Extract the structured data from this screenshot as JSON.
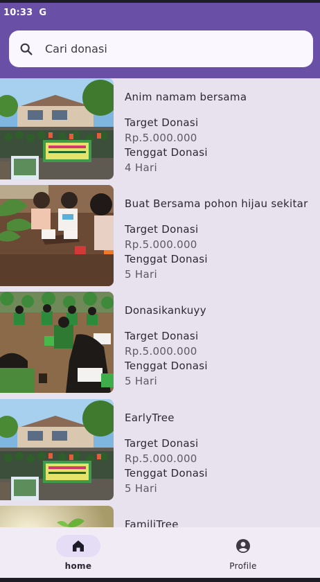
{
  "status_bar": {
    "time": "10:33",
    "app_letter": "G"
  },
  "search": {
    "placeholder": "Cari donasi",
    "icon": "search-icon"
  },
  "donations": [
    {
      "title": "Anim namam bersama",
      "target_label": "Target Donasi",
      "target_value": "Rp.5.000.000",
      "deadline_label": "Tenggat Donasi",
      "deadline_value": "4 Hari"
    },
    {
      "title": "Buat Bersama pohon hijau sekitar",
      "target_label": "Target Donasi",
      "target_value": "Rp.5.000.000",
      "deadline_label": "Tenggat Donasi",
      "deadline_value": "5 Hari"
    },
    {
      "title": "Donasikankuyy",
      "target_label": "Target Donasi",
      "target_value": "Rp.5.000.000",
      "deadline_label": "Tenggat Donasi",
      "deadline_value": "5 Hari"
    },
    {
      "title": "EarlyTree",
      "target_label": "Target Donasi",
      "target_value": "Rp.5.000.000",
      "deadline_label": "Tenggat Donasi",
      "deadline_value": "5 Hari"
    },
    {
      "title": "FamiliTree",
      "target_label": "",
      "target_value": "",
      "deadline_label": "",
      "deadline_value": ""
    }
  ],
  "bottom_nav": {
    "items": [
      {
        "label": "home",
        "icon": "home-icon",
        "active": true
      },
      {
        "label": "Profile",
        "icon": "account-circle-icon",
        "active": false
      }
    ]
  },
  "colors": {
    "primary": "#6a4fa6",
    "background": "#e8e1ee",
    "nav_background": "#f1ebf6",
    "active_pill": "#e5dcf5"
  }
}
